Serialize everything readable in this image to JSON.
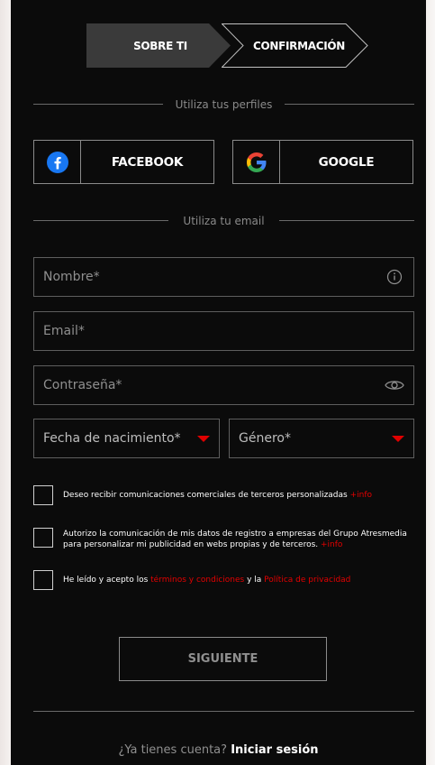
{
  "steps": [
    {
      "label": "SOBRE TI",
      "active": true
    },
    {
      "label": "CONFIRMACIÓN",
      "active": false
    }
  ],
  "separators": {
    "profiles": "Utiliza tus perfiles",
    "email": "Utiliza tu email"
  },
  "social": {
    "facebook_label": "FACEBOOK",
    "google_label": "GOOGLE"
  },
  "form": {
    "name_placeholder": "Nombre*",
    "email_placeholder": "Email*",
    "password_placeholder": "Contraseña*",
    "birthdate_placeholder": "Fecha de nacimiento*",
    "gender_placeholder": "Género*"
  },
  "consents": {
    "marketing_text": "Deseo recibir comunicaciones comerciales de terceros personalizadas ",
    "marketing_link": "+info",
    "share_text": "Autorizo la comunicación de mis datos de registro a empresas del Grupo Atresmedia para personalizar mi publicidad en webs propias y de terceros. ",
    "share_link": "+info",
    "terms_prefix": "He leído y acepto los ",
    "terms_link": "términos y condiciones",
    "terms_mid": " y la ",
    "privacy_link": "Política de privacidad"
  },
  "next_label": "SIGUIENTE",
  "login": {
    "question": "¿Ya tienes cuenta?",
    "link": "Iniciar sesión"
  },
  "colors": {
    "accent": "#e40000",
    "background": "#0b0b0b",
    "active_step": "#3a3a3a"
  }
}
